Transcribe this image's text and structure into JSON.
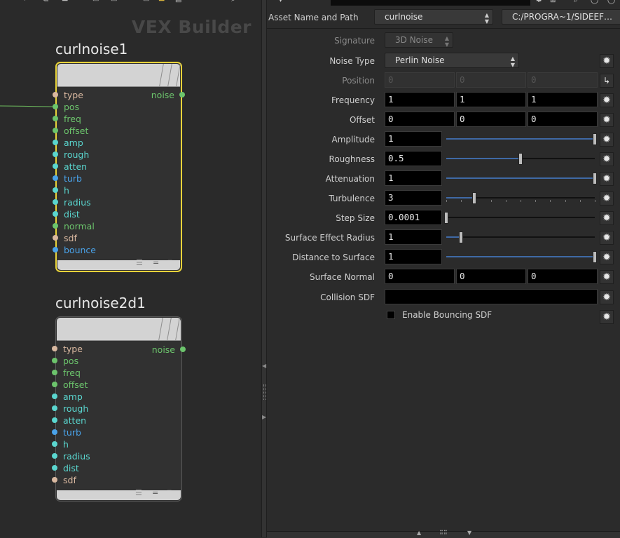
{
  "network": {
    "watermark": "VEX Builder",
    "nodes": [
      {
        "name": "curlnoise1",
        "selected": true,
        "inputs": [
          {
            "label": "type",
            "color": "#d9b8a0"
          },
          {
            "label": "pos",
            "color": "#6cc46c"
          },
          {
            "label": "freq",
            "color": "#6cc46c"
          },
          {
            "label": "offset",
            "color": "#6cc46c"
          },
          {
            "label": "amp",
            "color": "#5ad6cf"
          },
          {
            "label": "rough",
            "color": "#5ad6cf"
          },
          {
            "label": "atten",
            "color": "#5ad6cf"
          },
          {
            "label": "turb",
            "color": "#4aa3ea"
          },
          {
            "label": "h",
            "color": "#5ad6cf"
          },
          {
            "label": "radius",
            "color": "#5ad6cf"
          },
          {
            "label": "dist",
            "color": "#5ad6cf"
          },
          {
            "label": "normal",
            "color": "#6cc46c"
          },
          {
            "label": "sdf",
            "color": "#d9b8a0"
          },
          {
            "label": "bounce",
            "color": "#4aa3ea"
          }
        ],
        "output": {
          "label": "noise",
          "color": "#6cc46c"
        }
      },
      {
        "name": "curlnoise2d1",
        "selected": false,
        "inputs": [
          {
            "label": "type",
            "color": "#d9b8a0"
          },
          {
            "label": "pos",
            "color": "#6cc46c"
          },
          {
            "label": "freq",
            "color": "#6cc46c"
          },
          {
            "label": "offset",
            "color": "#6cc46c"
          },
          {
            "label": "amp",
            "color": "#5ad6cf"
          },
          {
            "label": "rough",
            "color": "#5ad6cf"
          },
          {
            "label": "atten",
            "color": "#5ad6cf"
          },
          {
            "label": "turb",
            "color": "#4aa3ea"
          },
          {
            "label": "h",
            "color": "#5ad6cf"
          },
          {
            "label": "radius",
            "color": "#5ad6cf"
          },
          {
            "label": "dist",
            "color": "#5ad6cf"
          },
          {
            "label": "sdf",
            "color": "#d9b8a0"
          }
        ],
        "output": {
          "label": "noise",
          "color": "#6cc46c"
        }
      }
    ]
  },
  "asset": {
    "label": "Asset Name and Path",
    "name": "curlnoise",
    "path": "C:/PROGRA~1/SIDEEF…"
  },
  "params": {
    "signature": {
      "label": "Signature",
      "value": "3D Noise"
    },
    "noise_type": {
      "label": "Noise Type",
      "value": "Perlin Noise"
    },
    "position": {
      "label": "Position",
      "values": [
        "0",
        "0",
        "0"
      ]
    },
    "frequency": {
      "label": "Frequency",
      "values": [
        "1",
        "1",
        "1"
      ]
    },
    "offset": {
      "label": "Offset",
      "values": [
        "0",
        "0",
        "0"
      ]
    },
    "amplitude": {
      "label": "Amplitude",
      "value": "1",
      "slider_fraction": 1.0
    },
    "roughness": {
      "label": "Roughness",
      "value": "0.5",
      "slider_fraction": 0.5
    },
    "attenuation": {
      "label": "Attenuation",
      "value": "1",
      "slider_fraction": 1.0
    },
    "turbulence": {
      "label": "Turbulence",
      "value": "3",
      "slider_fraction": 0.19
    },
    "step_size": {
      "label": "Step Size",
      "value": "0.0001",
      "slider_fraction": 0.0
    },
    "surface_effect_radius": {
      "label": "Surface Effect Radius",
      "value": "1",
      "slider_fraction": 0.1
    },
    "distance_to_surface": {
      "label": "Distance to Surface",
      "value": "1",
      "slider_fraction": 1.0
    },
    "surface_normal": {
      "label": "Surface Normal",
      "values": [
        "0",
        "0",
        "0"
      ]
    },
    "collision_sdf": {
      "label": "Collision SDF",
      "value": ""
    },
    "enable_bouncing": {
      "label": "Enable Bouncing SDF",
      "checked": false
    }
  },
  "icons": {
    "gear": "gear-icon",
    "channel": "channel-icon"
  },
  "colors": {
    "selection": "#e8d33a",
    "slider_fill": "#3f69a5"
  }
}
